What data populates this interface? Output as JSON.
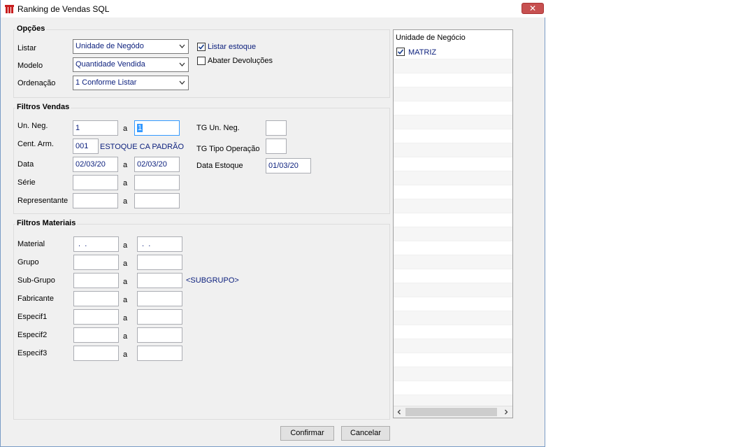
{
  "window": {
    "title": "Ranking de Vendas SQL",
    "close_glyph": "✕"
  },
  "opcoes": {
    "title": "Opções",
    "listar_label": "Listar",
    "listar_value": "Unidade de Negódo",
    "modelo_label": "Modelo",
    "modelo_value": "Quantidade Vendida",
    "ordenacao_label": "Ordenação",
    "ordenacao_value": "1 Conforme Listar",
    "listar_estoque_label": "Listar estoque",
    "listar_estoque_checked": true,
    "abater_devolucoes_label": "Abater Devoluções",
    "abater_devolucoes_checked": false
  },
  "filtros_vendas": {
    "title": "Filtros Vendas",
    "range_sep": "a",
    "un_neg_label": "Un. Neg.",
    "un_neg_from": "1",
    "un_neg_to": "1",
    "cent_arm_label": "Cent. Arm.",
    "cent_arm_value": "001",
    "cent_arm_desc": "ESTOQUE CA PADRÃO",
    "data_label": "Data",
    "data_from": "02/03/20",
    "data_to": "02/03/20",
    "serie_label": "Série",
    "serie_from": "",
    "serie_to": "",
    "representante_label": "Representante",
    "representante_from": "",
    "representante_to": "",
    "tg_un_neg_label": "TG Un. Neg.",
    "tg_un_neg_value": "",
    "tg_tipo_operacao_label": "TG Tipo Operação",
    "tg_tipo_operacao_value": "",
    "data_estoque_label": "Data Estoque",
    "data_estoque_value": "01/03/20"
  },
  "filtros_materiais": {
    "title": "Filtros Materiais",
    "range_sep": "a",
    "material_label": "Material",
    "material_from": " .  .",
    "material_to": " .  .",
    "grupo_label": "Grupo",
    "subgrupo_label": "Sub-Grupo",
    "subgrupo_desc": "<SUBGRUPO>",
    "fabricante_label": "Fabricante",
    "especif1_label": "Especif1",
    "especif2_label": "Especif2",
    "especif3_label": "Especif3"
  },
  "unidade_negocio": {
    "header": "Unidade de Negócio",
    "items": [
      {
        "label": "MATRIZ",
        "checked": true
      }
    ]
  },
  "buttons": {
    "confirmar": "Confirmar",
    "cancelar": "Cancelar"
  },
  "colors": {
    "value_text": "#0a1e7c",
    "close_button": "#c75050",
    "selection": "#3399ff"
  },
  "icons": [
    "app-logo-icon",
    "close-icon",
    "chevron-down-icon",
    "checkmark-icon",
    "chevron-left-icon",
    "chevron-right-icon"
  ]
}
